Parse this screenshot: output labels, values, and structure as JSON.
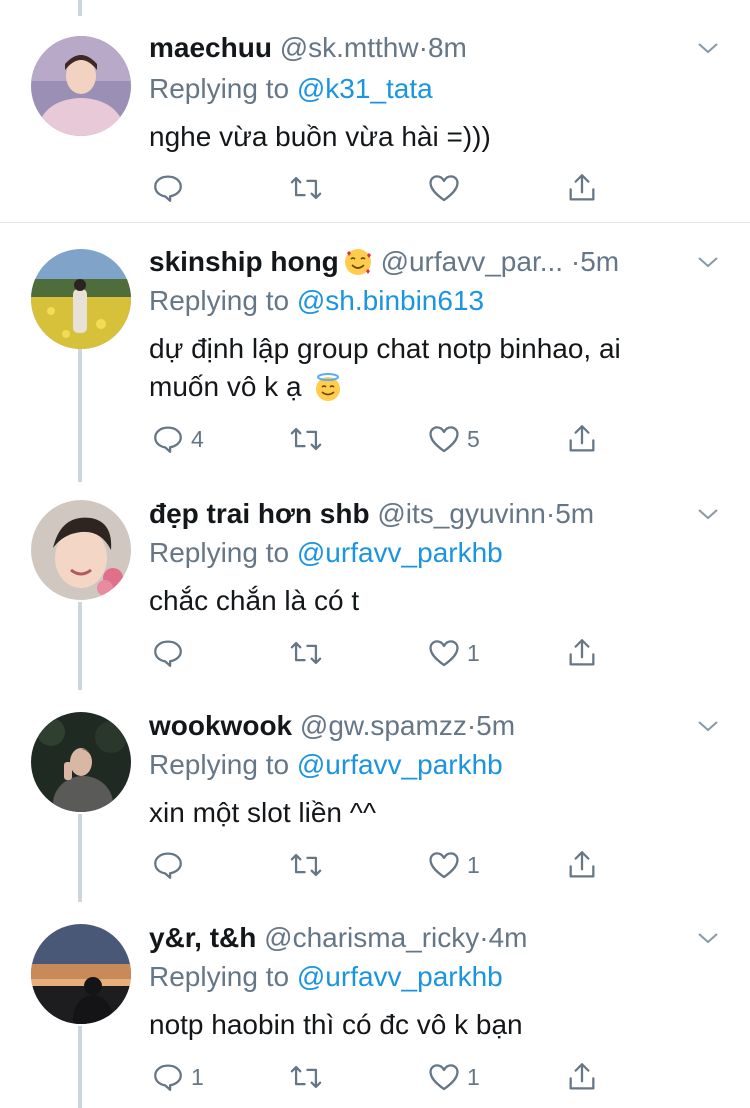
{
  "tweets": [
    {
      "name": "maechuu",
      "has_emoji": false,
      "handle": "@sk.mtthw",
      "separator": "·",
      "time": "8m",
      "reply_prefix": "Replying to ",
      "reply_to": "@k31_tata",
      "lines": [
        "nghe vừa buồn vừa hài =)))",
        ""
      ],
      "reply_count": "",
      "retweet_count": "",
      "like_count": "",
      "avatar": "avatar-man-pink-jacket"
    },
    {
      "name": "skinship hong",
      "has_emoji": true,
      "name_emoji": "smiling-face-with-hearts",
      "handle": "@urfavv_par...",
      "separator": "·",
      "time": "5m",
      "reply_prefix": "Replying to ",
      "reply_to": "@sh.binbin613",
      "lines": [
        "dự định lập group chat notp binhao, ai",
        "muốn vô k ạ"
      ],
      "text_emoji": "smiling-face-with-halo",
      "reply_count": "4",
      "retweet_count": "",
      "like_count": "5",
      "avatar": "avatar-flower-field"
    },
    {
      "name": "đẹp trai hơn shb",
      "has_emoji": false,
      "handle": "@its_gyuvinn",
      "separator": "·",
      "time": "5m",
      "reply_prefix": "Replying to ",
      "reply_to": "@urfavv_parkhb",
      "lines": [
        "chắc chắn là có t",
        ""
      ],
      "reply_count": "",
      "retweet_count": "",
      "like_count": "1",
      "avatar": "avatar-boy-smiling"
    },
    {
      "name": "wookwook",
      "has_emoji": false,
      "handle": "@gw.spamzz",
      "separator": "·",
      "time": "5m",
      "reply_prefix": "Replying to ",
      "reply_to": "@urfavv_parkhb",
      "lines": [
        "xin một slot liền ^^",
        ""
      ],
      "reply_count": "",
      "retweet_count": "",
      "like_count": "1",
      "avatar": "avatar-night-park"
    },
    {
      "name": "y&r, t&h",
      "has_emoji": false,
      "handle": "@charisma_ricky",
      "separator": "·",
      "time": "4m",
      "reply_prefix": "Replying to ",
      "reply_to": "@urfavv_parkhb",
      "lines": [
        "notp haobin thì có đc vô k bạn",
        ""
      ],
      "reply_count": "1",
      "retweet_count": "",
      "like_count": "1",
      "avatar": "avatar-sunset-silhouette"
    }
  ],
  "colors": {
    "text": "#14171a",
    "secondary": "#657786",
    "link": "#1b95e0",
    "icon": "#657786",
    "thread_line": "#ccd6dd",
    "divider": "#e1e8ed"
  }
}
